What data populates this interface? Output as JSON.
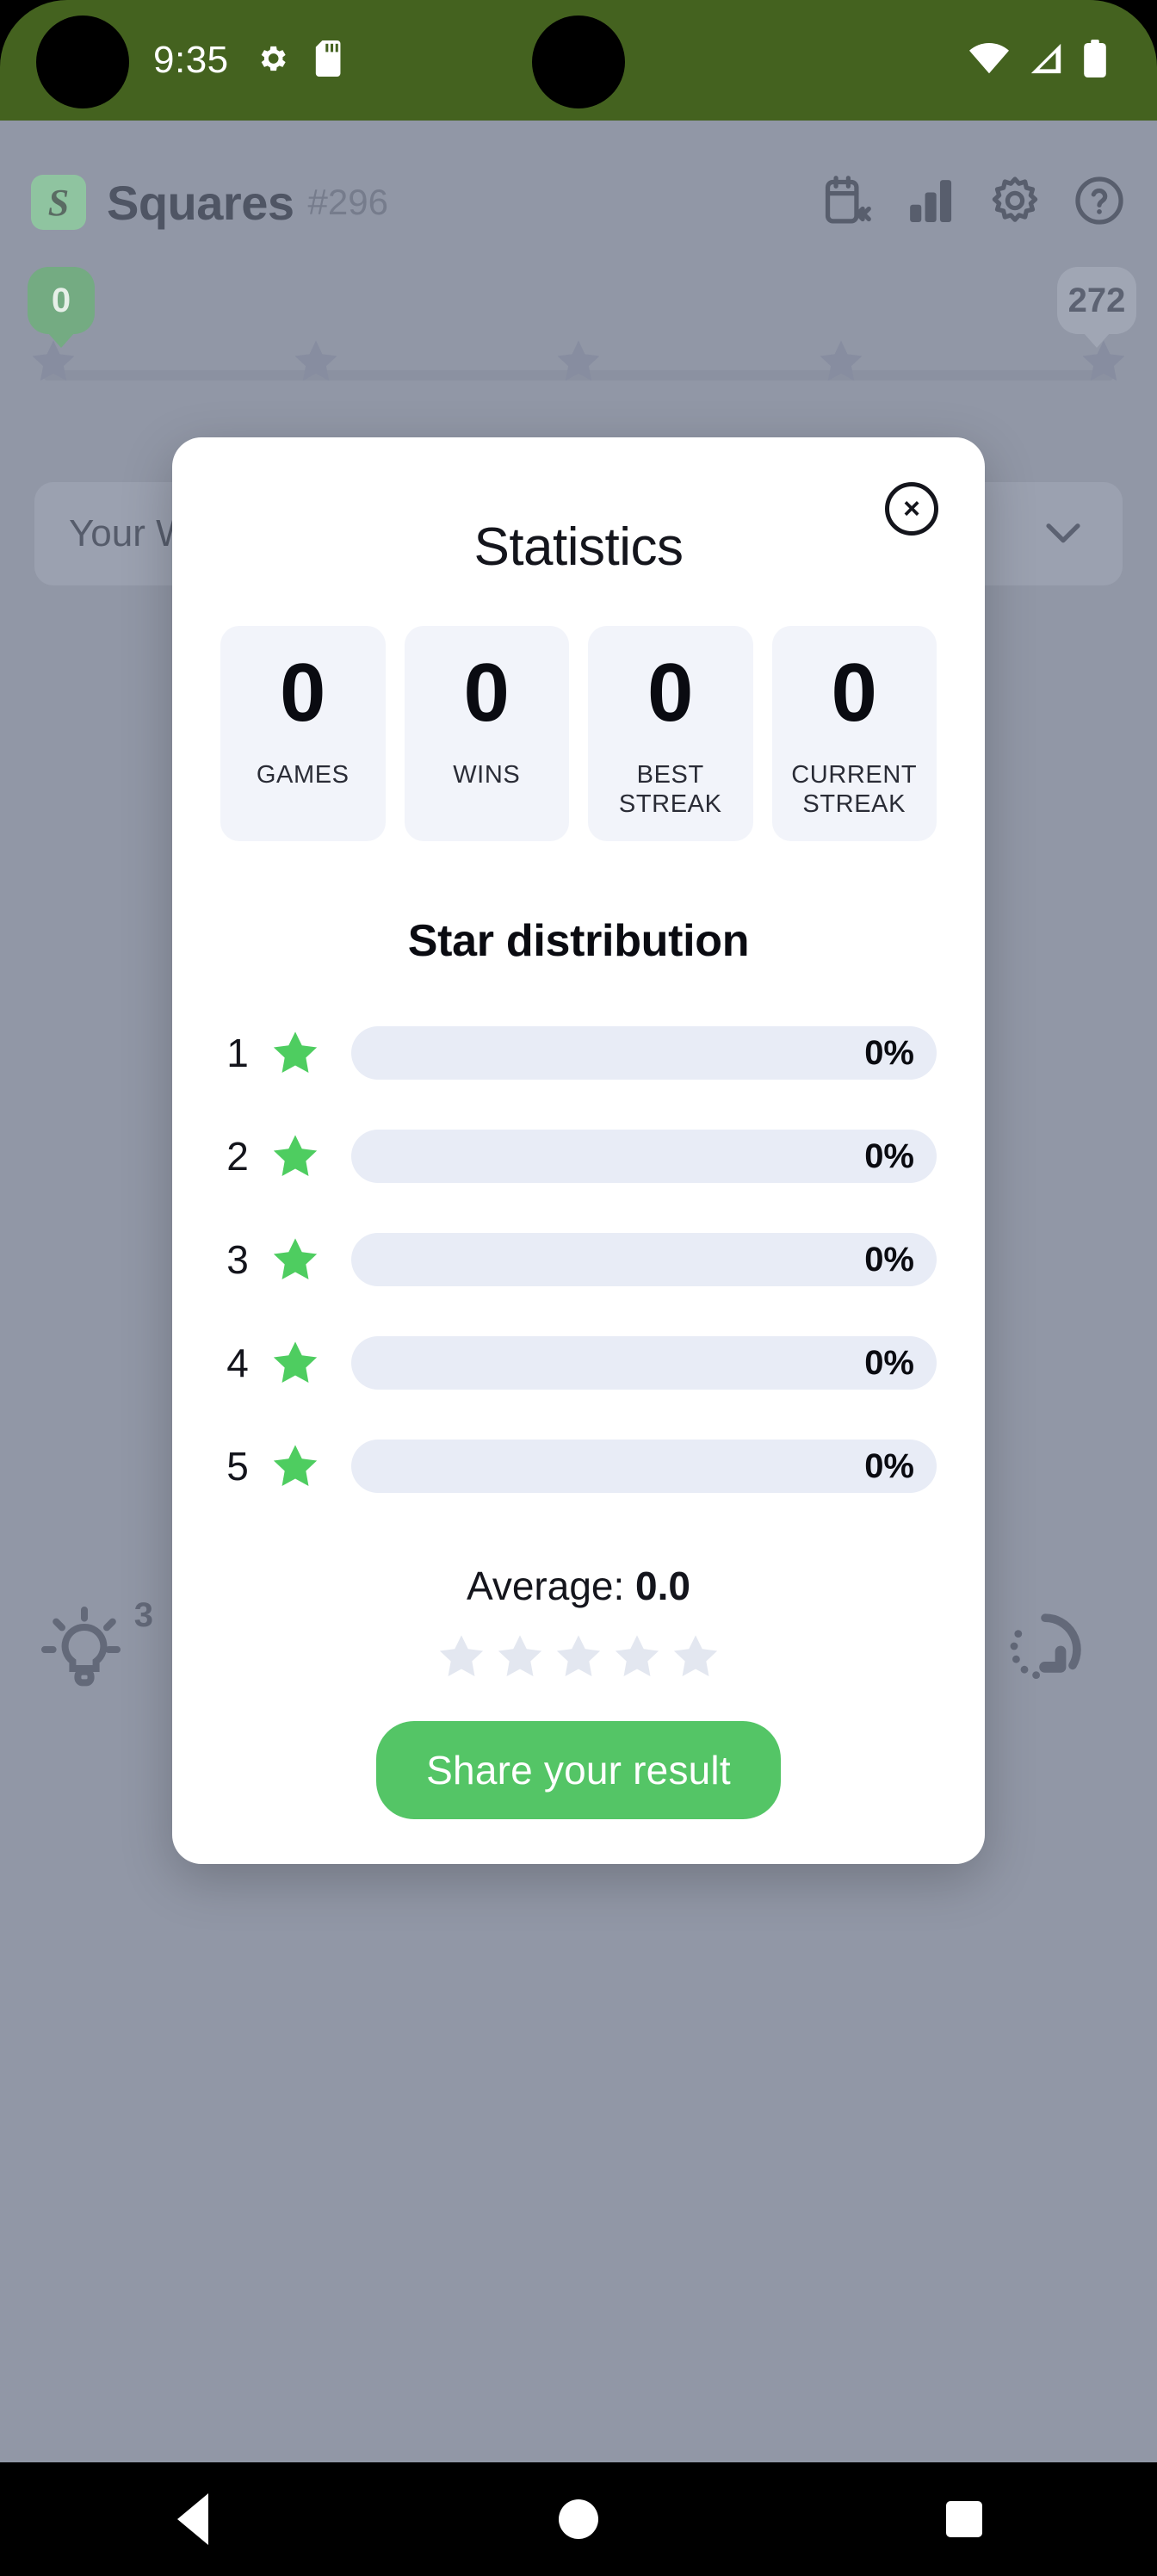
{
  "status_bar": {
    "time": "9:35",
    "icons": [
      "gear-icon",
      "sd-card-icon",
      "wifi-icon",
      "cellular-signal-icon",
      "battery-icon"
    ],
    "background_color": "#44621f"
  },
  "app": {
    "logo_letter": "S",
    "title": "Squares",
    "puzzle_number": "#296",
    "header_icons": [
      "archive-calendar-icon",
      "bar-chart-icon",
      "gear-icon",
      "help-icon"
    ],
    "progress": {
      "current_badge": "0",
      "total_badge": "272",
      "star_markers": 5
    },
    "word_row": {
      "text": "Your W",
      "chevron": "chevron-down-icon"
    },
    "tools": {
      "hint_label": "hint-bulb-icon",
      "hint_count": "3",
      "reset_label": "restart-icon"
    },
    "backdrop_color": "#9197a6"
  },
  "modal": {
    "title": "Statistics",
    "close_label": "×",
    "stats": [
      {
        "value": "0",
        "label": "GAMES"
      },
      {
        "value": "0",
        "label": "WINS"
      },
      {
        "value": "0",
        "label": "BEST STREAK"
      },
      {
        "value": "0",
        "label": "CURRENT STREAK"
      }
    ],
    "distribution_title": "Star distribution",
    "average_prefix": "Average: ",
    "average_value": "0.0",
    "average_star_count": 5,
    "share_label": "Share your result",
    "accent_color": "#54c566",
    "star_color": "#4ecd60",
    "bar_track_color": "#e8ecf6",
    "card_color": "#f2f4fa"
  },
  "chart_data": {
    "type": "bar",
    "title": "Star distribution",
    "orientation": "horizontal",
    "categories": [
      "1",
      "2",
      "3",
      "4",
      "5"
    ],
    "values": [
      0,
      0,
      0,
      0,
      0
    ],
    "value_labels": [
      "0%",
      "0%",
      "0%",
      "0%",
      "0%"
    ],
    "xlabel": "",
    "ylabel": "Stars",
    "xlim": [
      0,
      100
    ],
    "unit": "%",
    "grid": false,
    "legend": "none",
    "average": 0.0
  },
  "nav_bar": {
    "back": "back-triangle-icon",
    "home": "home-circle-icon",
    "recents": "recents-square-icon"
  }
}
